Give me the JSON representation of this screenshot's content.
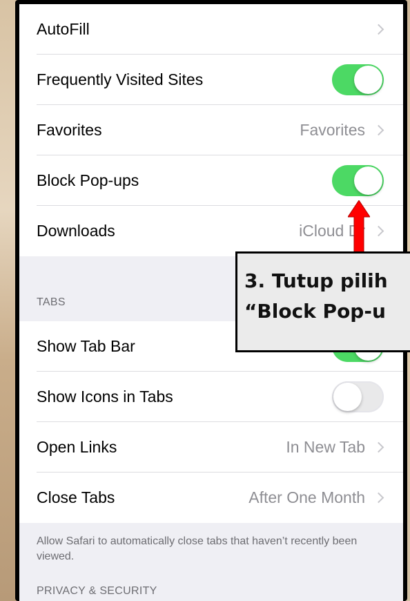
{
  "settings": {
    "rows_group1": [
      {
        "label": "AutoFill",
        "value": "",
        "control": "chevron"
      },
      {
        "label": "Frequently Visited Sites",
        "value": "",
        "control": "toggle-on"
      },
      {
        "label": "Favorites",
        "value": "Favorites",
        "control": "chevron"
      },
      {
        "label": "Block Pop-ups",
        "value": "",
        "control": "toggle-on"
      },
      {
        "label": "Downloads",
        "value": "iCloud Dr",
        "control": "chevron"
      }
    ],
    "tabs_header": "TABS",
    "rows_tabs": [
      {
        "label": "Show Tab Bar",
        "value": "",
        "control": "toggle-on"
      },
      {
        "label": "Show Icons in Tabs",
        "value": "",
        "control": "toggle-off"
      },
      {
        "label": "Open Links",
        "value": "In New Tab",
        "control": "chevron"
      },
      {
        "label": "Close Tabs",
        "value": "After One Month",
        "control": "chevron"
      }
    ],
    "tabs_footer": "Allow Safari to automatically close tabs that haven’t recently been viewed.",
    "privacy_header": "PRIVACY & SECURITY"
  },
  "annotation": {
    "line1": "3. Tutup pilih",
    "line2": "“Block Pop-u"
  },
  "colors": {
    "toggle_on": "#4cd964",
    "toggle_off": "#e9e9ea",
    "arrow": "#ff0000",
    "annotation_bg": "#ebebeb"
  }
}
